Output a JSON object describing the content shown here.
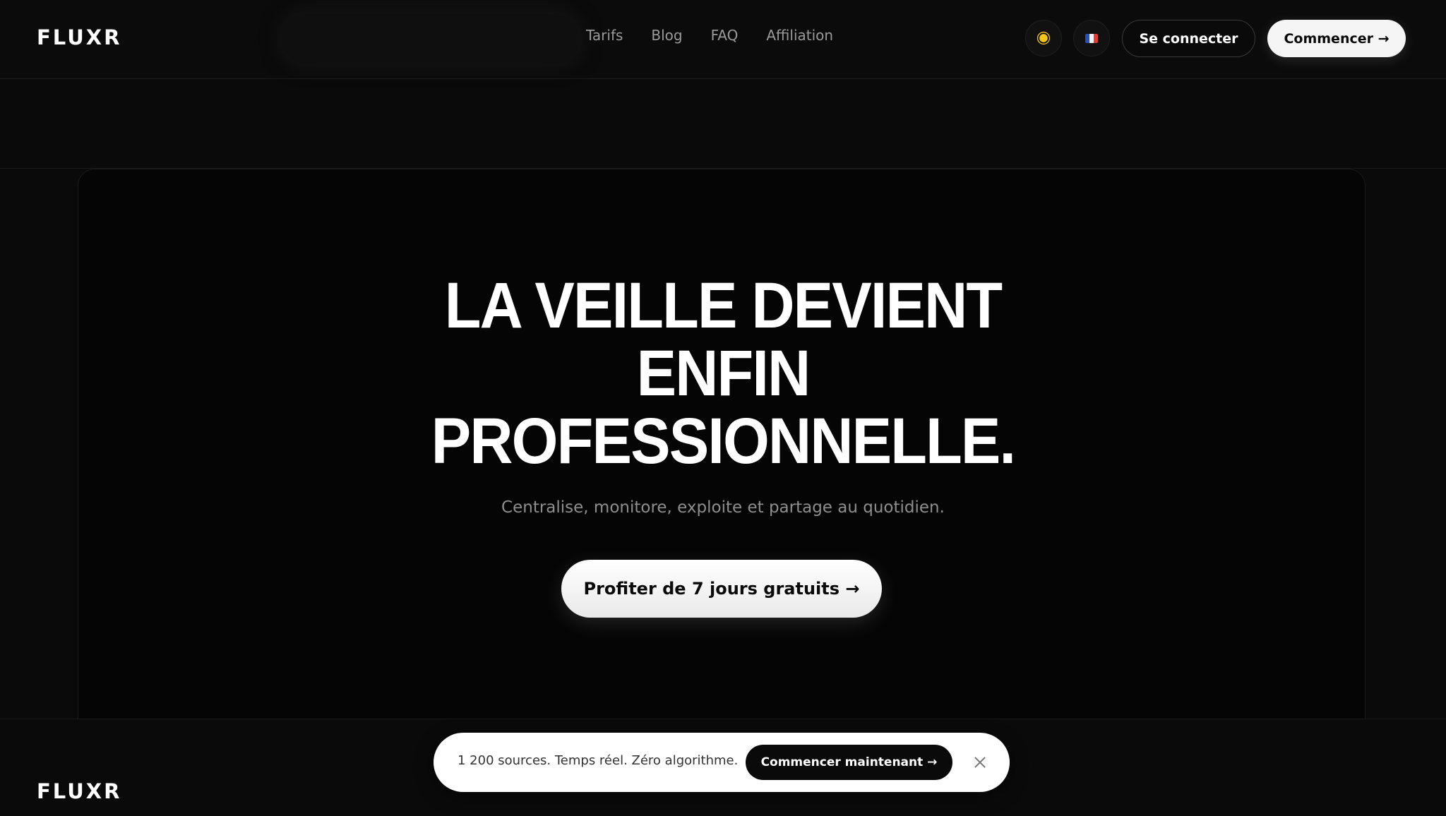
{
  "header": {
    "logo": "FLUXR",
    "nav": [
      "Tarifs",
      "Blog",
      "FAQ",
      "Affiliation"
    ],
    "theme_icon": "sun-icon",
    "language_icon": "french-flag-icon",
    "login_label": "Se connecter",
    "start_label": "Commencer →"
  },
  "hero": {
    "title_lines": [
      "LA VEILLE DEVIENT",
      "ENFIN",
      "PROFESSIONNELLE."
    ],
    "subtitle": "Centralise, monitore, exploite et partage au quotidien.",
    "cta_label": "Profiter de 7 jours gratuits →"
  },
  "footer": {
    "logo": "FLUXR"
  },
  "banner": {
    "text": "1 200 sources. Temps réel. Zéro algorithme.",
    "cta_label": "Commencer maintenant →",
    "close_icon": "close-icon"
  },
  "colors": {
    "background": "#0a0a0a",
    "text": "#ffffff",
    "muted": "#9a9a9a",
    "button_light": "#f5f5f5"
  }
}
